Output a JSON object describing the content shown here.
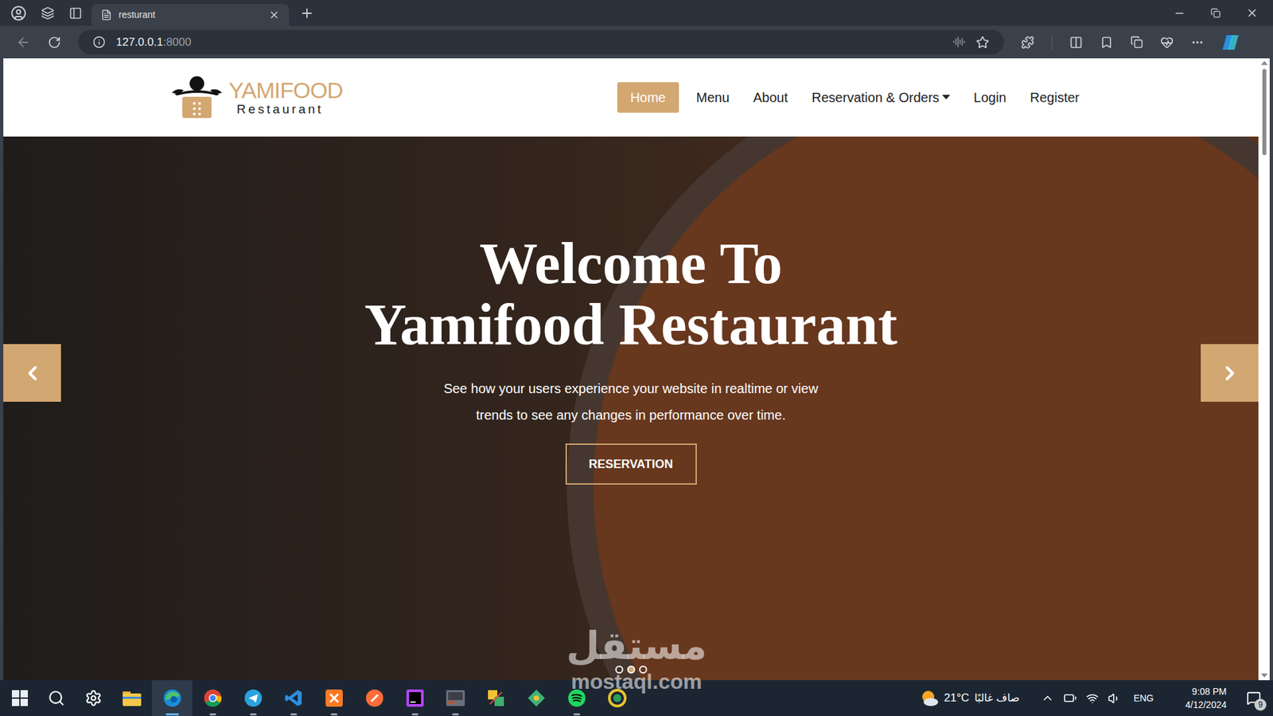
{
  "browser": {
    "tab": {
      "title": "resturant"
    },
    "address": {
      "host": "127.0.0.1",
      "port": ":8000"
    }
  },
  "logo": {
    "name": "YAMIFOOD",
    "subtitle": "Restaurant"
  },
  "nav": [
    {
      "label": "Home",
      "selected": true,
      "dropdown": false
    },
    {
      "label": "Menu",
      "selected": false,
      "dropdown": false
    },
    {
      "label": "About",
      "selected": false,
      "dropdown": false
    },
    {
      "label": "Reservation & Orders",
      "selected": false,
      "dropdown": true
    },
    {
      "label": "Login",
      "selected": false,
      "dropdown": false
    },
    {
      "label": "Register",
      "selected": false,
      "dropdown": false
    }
  ],
  "hero": {
    "title": [
      "Welcome To",
      "Yamifood Restaurant"
    ],
    "text": [
      "See how your users experience your website in realtime or view",
      "trends to see any changes in performance over time."
    ],
    "button": "RESERVATION",
    "slides": [
      {
        "selected": false
      },
      {
        "selected": true
      },
      {
        "selected": false
      }
    ]
  },
  "watermark": {
    "arabic": "مستقل",
    "latin": "mostaql.com"
  },
  "taskbar": {
    "apps": [
      {
        "running": false,
        "selected": false
      },
      {
        "running": true,
        "selected": true
      },
      {
        "running": true,
        "selected": false
      },
      {
        "running": true,
        "selected": false
      },
      {
        "running": true,
        "selected": false
      },
      {
        "running": true,
        "selected": false
      },
      {
        "running": false,
        "selected": false
      },
      {
        "running": true,
        "selected": false
      },
      {
        "running": true,
        "selected": false
      },
      {
        "running": false,
        "selected": false
      },
      {
        "running": false,
        "selected": false
      },
      {
        "running": true,
        "selected": false
      },
      {
        "running": false,
        "selected": false
      }
    ],
    "weather": {
      "temp": "21°C",
      "condition": "صاف غالبًا"
    },
    "language": "ENG",
    "time": "9:08 PM",
    "date": "4/12/2024",
    "notifications": "9"
  }
}
